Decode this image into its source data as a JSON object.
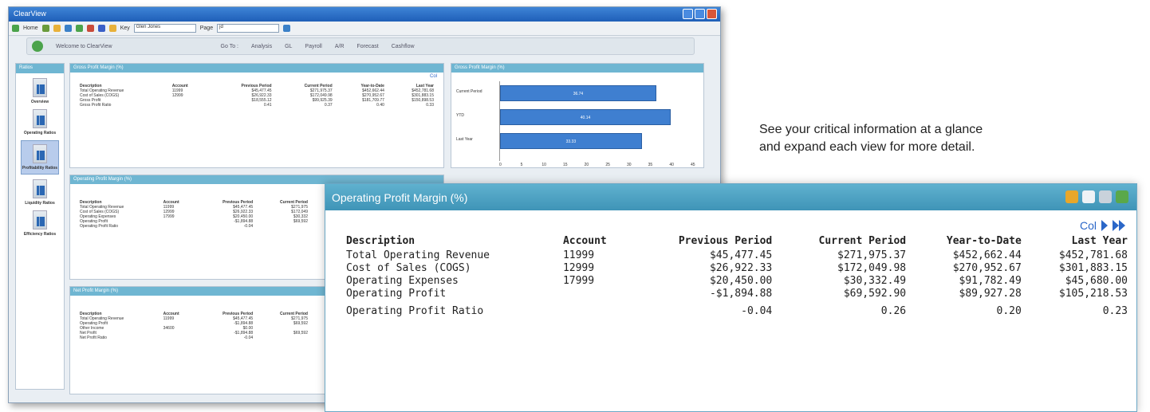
{
  "app": {
    "title": "ClearView",
    "toolbar": {
      "home_label": "Home",
      "key_label": "Key",
      "key_value": "Glen Jones",
      "page_label": "Page",
      "page_value": "jd"
    },
    "welcome_text": "Welcome to ClearView",
    "goto_label": "Go To :",
    "nav_links": [
      "Analysis",
      "GL",
      "Payroll",
      "A/R",
      "Forecast",
      "Cashflow"
    ]
  },
  "sidebar": {
    "header": "Ratios",
    "items": [
      {
        "label": "Overview"
      },
      {
        "label": "Operating Ratios"
      },
      {
        "label": "Profitability Ratios",
        "active": true
      },
      {
        "label": "Liquidity Ratios"
      },
      {
        "label": "Efficiency Ratios"
      }
    ]
  },
  "mini_gross": {
    "title": "Gross Profit Margin (%)",
    "col_nav": "Col",
    "headers": [
      "Description",
      "Account",
      "Previous Period",
      "Current Period",
      "Year-to-Date",
      "Last Year"
    ],
    "rows": [
      [
        "Total Operating Revenue",
        "11999",
        "$45,477.45",
        "$271,975.37",
        "$452,662.44",
        "$452,781.68"
      ],
      [
        "Cost of Sales (COGS)",
        "12999",
        "$26,922.33",
        "$172,049.98",
        "$270,952.67",
        "$301,883.15"
      ],
      [
        "Gross Profit",
        "",
        "$18,555.12",
        "$99,925.39",
        "$181,709.77",
        "$150,898.53"
      ]
    ],
    "ratio": [
      "Gross Profit Ratio",
      "",
      "0.41",
      "0.37",
      "0.40",
      "0.33"
    ]
  },
  "mini_chart": {
    "title": "Gross Profit Margin (%)",
    "bars": [
      {
        "label": "Current Period",
        "value": 36.74
      },
      {
        "label": "YTD",
        "value": 40.14
      },
      {
        "label": "Last Year",
        "value": 33.33
      }
    ],
    "ticks": [
      "0",
      "5",
      "10",
      "15",
      "20",
      "25",
      "30",
      "35",
      "40",
      "45"
    ]
  },
  "mini_operating": {
    "title": "Operating Profit Margin (%)",
    "headers": [
      "Description",
      "Account",
      "Previous Period",
      "Current Period"
    ],
    "rows": [
      [
        "Total Operating Revenue",
        "11999",
        "$45,477.45",
        "$271,975"
      ],
      [
        "Cost of Sales (COGS)",
        "12999",
        "$26,922.33",
        "$172,049"
      ],
      [
        "Operating Expenses",
        "17999",
        "$20,450.00",
        "$30,332"
      ],
      [
        "Operating Profit",
        "",
        "-$1,894.88",
        "$69,592"
      ]
    ],
    "ratio": [
      "Operating Profit Ratio",
      "",
      "-0.04",
      ""
    ]
  },
  "mini_net": {
    "title": "Net Profit Margin (%)",
    "headers": [
      "Description",
      "Account",
      "Previous Period",
      "Current Period"
    ],
    "rows": [
      [
        "Total Operating Revenue",
        "11999",
        "$45,477.45",
        "$271,975"
      ],
      [
        "Operating Profit",
        "",
        "-$1,894.88",
        "$69,592"
      ],
      [
        "Other Income",
        "34600",
        "$0.00",
        ""
      ],
      [
        "Net Profit",
        "",
        "-$1,894.88",
        "$69,592"
      ]
    ],
    "ratio": [
      "Net Profit Ratio",
      "",
      "-0.04",
      ""
    ]
  },
  "tagline": [
    "See your critical information at a glance",
    "and expand each view for more detail."
  ],
  "main_panel": {
    "title": "Operating Profit Margin (%)",
    "col_nav": "Col",
    "headers": [
      "Description",
      "Account",
      "Previous Period",
      "Current Period",
      "Year-to-Date",
      "Last Year"
    ],
    "rows": [
      [
        "Total Operating Revenue",
        "11999",
        "$45,477.45",
        "$271,975.37",
        "$452,662.44",
        "$452,781.68"
      ],
      [
        "Cost of Sales (COGS)",
        "12999",
        "$26,922.33",
        "$172,049.98",
        "$270,952.67",
        "$301,883.15"
      ],
      [
        "Operating Expenses",
        "17999",
        "$20,450.00",
        "$30,332.49",
        "$91,782.49",
        "$45,680.00"
      ],
      [
        "Operating Profit",
        "",
        "-$1,894.88",
        "$69,592.90",
        "$89,927.28",
        "$105,218.53"
      ]
    ],
    "ratio": [
      "Operating Profit Ratio",
      "",
      "-0.04",
      "0.26",
      "0.20",
      "0.23"
    ]
  }
}
